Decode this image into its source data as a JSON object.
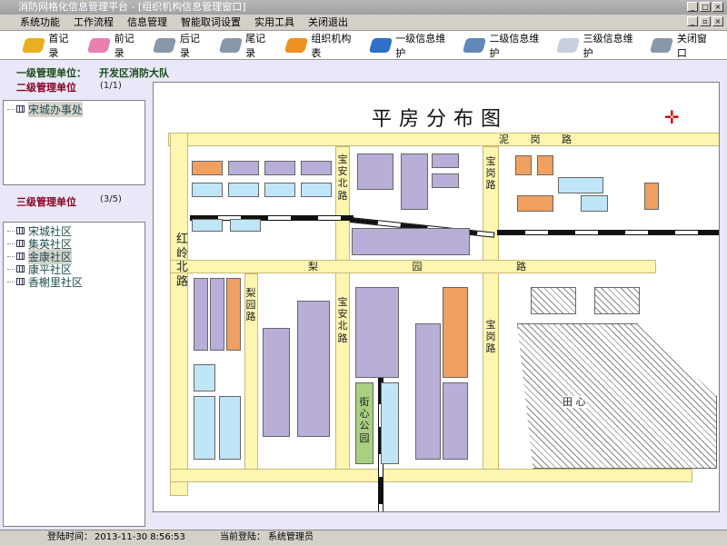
{
  "window": {
    "title": "消防网格化信息管理平台 - [组织机构信息管理窗口]"
  },
  "menu": [
    "系统功能",
    "工作流程",
    "信息管理",
    "智能取词设置",
    "实用工具",
    "关闭退出"
  ],
  "toolbar": [
    {
      "label": "首记录",
      "icon": "first-record-icon",
      "color": "#e8b020"
    },
    {
      "label": "前记录",
      "icon": "prev-record-icon",
      "color": "#e880b0"
    },
    {
      "label": "后记录",
      "icon": "next-record-icon",
      "color": "#8898a8"
    },
    {
      "label": "尾记录",
      "icon": "last-record-icon",
      "color": "#8898a8"
    },
    {
      "label": "组织机构表",
      "icon": "org-table-icon",
      "color": "#f09020"
    },
    {
      "label": "一级信息维护",
      "icon": "level1-icon",
      "color": "#3070c8"
    },
    {
      "label": "二级信息维护",
      "icon": "level2-icon",
      "color": "#6088b8"
    },
    {
      "label": "三级信息维护",
      "icon": "level3-icon",
      "color": "#c8d0e0"
    },
    {
      "label": "关闭窗口",
      "icon": "close-window-icon",
      "color": "#8898a8"
    }
  ],
  "level1": {
    "label": "一级管理单位：",
    "value": "开发区消防大队"
  },
  "level2": {
    "label": "二级管理单位",
    "count": "(1/1)",
    "items": [
      "宋城办事处"
    ]
  },
  "level3": {
    "label": "三级管理单位",
    "count": "(3/5)",
    "items": [
      "宋城社区",
      "集英社区",
      "金康社区",
      "康平社区",
      "香榭里社区"
    ]
  },
  "map": {
    "title": "平房分布图",
    "roads": {
      "top": "泥 岗 路",
      "left": "红岭北路",
      "mid": "宝安北路",
      "mid2": "宝安北路",
      "east": "宝岗路",
      "east2": "宝岗路",
      "lili": "梨 园 路",
      "liv": "梨园路"
    },
    "park": "街心公园",
    "tianxin": "田      心"
  },
  "status": {
    "login_label": "登陆时间：",
    "login_time": "2013-11-30 8:56:53",
    "user_label": "当前登陆：",
    "user": "系统管理员"
  }
}
